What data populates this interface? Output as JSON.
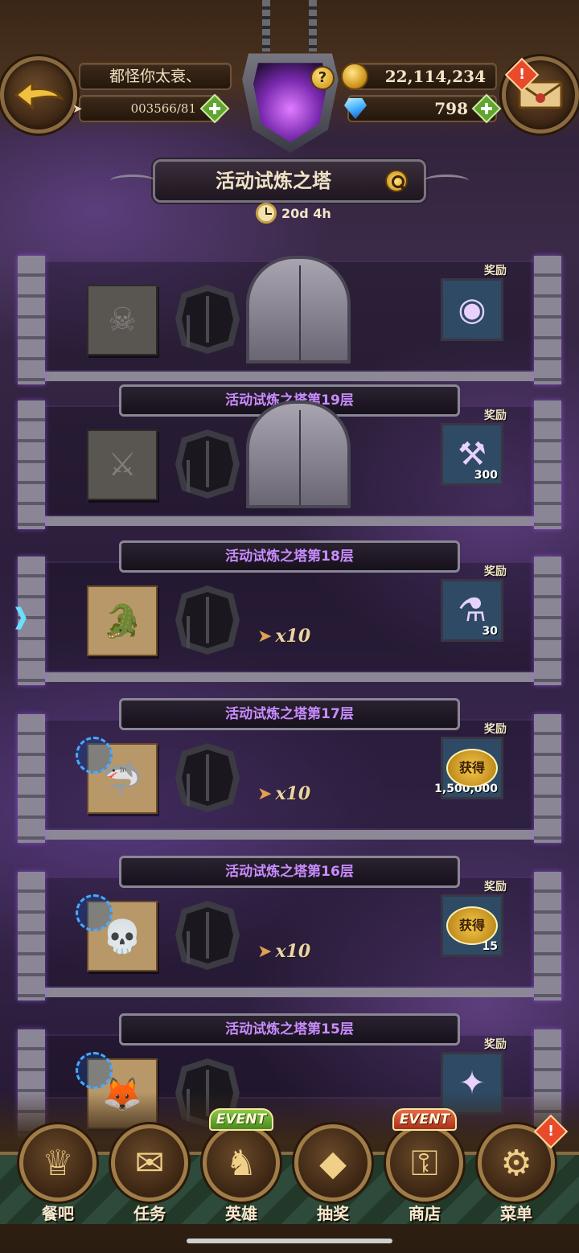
{
  "header": {
    "player_name": "都怪你太衰、",
    "energy": "003566/81",
    "gold": "22,114,234",
    "gems": "798",
    "help_badge": "?",
    "alert_badge": "!"
  },
  "title": {
    "text": "活动试炼之塔",
    "timer": "20d 4h"
  },
  "floors": [
    {
      "label": "",
      "locked": true,
      "monster_icon": "hooded-monster-icon",
      "show_gate": true,
      "cost": "",
      "reward_label": "奖励",
      "reward_icon": "orb-icon",
      "reward_count": "",
      "obtained": false
    },
    {
      "label": "活动试炼之塔第19层",
      "locked": true,
      "monster_icon": "armored-knight-icon",
      "show_gate": true,
      "cost": "",
      "reward_label": "奖励",
      "reward_icon": "anvil-icon",
      "reward_count": "300",
      "obtained": false
    },
    {
      "label": "活动试炼之塔第18层",
      "locked": false,
      "monster_icon": "green-dragon-icon",
      "show_gate": false,
      "cost": "x10",
      "reward_label": "奖励",
      "reward_icon": "potion-icon",
      "reward_count": "30",
      "obtained": false
    },
    {
      "label": "活动试炼之塔第17层",
      "locked": false,
      "monster_icon": "blue-shark-icon",
      "show_gate": false,
      "cost": "x10",
      "reward_label": "奖励",
      "reward_icon": "gold-coins-icon",
      "reward_count": "1,500,000",
      "obtained": true,
      "obtained_text": "获得"
    },
    {
      "label": "活动试炼之塔第16层",
      "locked": false,
      "monster_icon": "pirate-monster-icon",
      "show_gate": false,
      "cost": "x10",
      "reward_label": "奖励",
      "reward_icon": "chest-icon",
      "reward_count": "15",
      "obtained": true,
      "obtained_text": "获得"
    },
    {
      "label": "活动试炼之塔第15层",
      "locked": false,
      "monster_icon": "fox-monster-icon",
      "show_gate": false,
      "cost": "",
      "reward_label": "奖励",
      "reward_icon": "scroll-icon",
      "reward_count": "",
      "obtained": false
    }
  ],
  "nav": {
    "items": [
      {
        "label": "餐吧",
        "icon": "bar-icon",
        "event": ""
      },
      {
        "label": "任务",
        "icon": "quest-scroll-icon",
        "event": ""
      },
      {
        "label": "英雄",
        "icon": "helmet-icon",
        "event": "EVENT"
      },
      {
        "label": "抽奖",
        "icon": "crystal-icon",
        "event": ""
      },
      {
        "label": "商店",
        "icon": "shop-icon",
        "event": "EVENT"
      },
      {
        "label": "菜单",
        "icon": "gear-icon",
        "event": ""
      }
    ]
  },
  "colors": {
    "floor_label": "#c98cff",
    "accent_gold": "#d49a20",
    "plus_green": "#5fa630"
  }
}
